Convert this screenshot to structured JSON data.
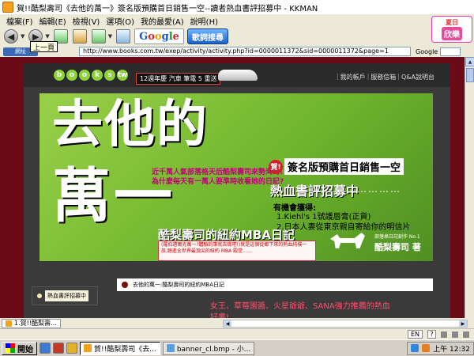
{
  "window": {
    "title": "賀!!酷梨壽司《去他的萬一》簽名版預購首日銷售一空--讀者熱血書評招募中 - KKMAN"
  },
  "menu": [
    "檔案(F)",
    "編輯(E)",
    "檢視(V)",
    "選項(O)",
    "我的最愛(A)",
    "說明(H)"
  ],
  "toolbar": {
    "back_tooltip": "上一頁",
    "song_search": "歌詞搜尋",
    "google_logo": "Google"
  },
  "app_logo": {
    "top": "夏日",
    "bottom": "欣樂"
  },
  "address": {
    "label": "網址",
    "url": "http://www.books.com.tw/exep/activity/activity.php?id=0000011372&sid=0000011372&page=1",
    "search_engine": "Google"
  },
  "site": {
    "logo_letters": [
      "b",
      "o",
      "o",
      "k",
      "s",
      "tw"
    ],
    "nav_badge": "12週年慶 汽車 筆電 5 重送",
    "nav_links": [
      "我的帳戶",
      "服務信箱",
      "Q&A說明台"
    ]
  },
  "banner": {
    "title_line1": "去他的",
    "title_line2": "萬一",
    "promo_line1": "近千萬人氣部落格天后酷梨壽司來勢洶洶!",
    "promo_line2": "為什麼每天有一萬人要準時收看她的日記?",
    "subtitle": "酷梨壽司的紐約MBA日記",
    "note": "(羅伯邁爾克萬一?體驗的事就去做吧!)就是這個從鄉下來的熱血純樸一族,踏進全世界最頂尖的紐約 MBA 殿堂……",
    "headline_badge": "賀!",
    "headline_text": "簽名版預購首日銷售一空",
    "recruit": "熱血書評招募中",
    "recruit_dots": "……………",
    "chance": "有機會獲得:",
    "prizes": [
      "1.Kiehl's 1號護唇膏(正貨)",
      "2.日本人妻從東京親自寄給你的明信片"
    ],
    "author_caption": "部落格日記創作 No.1",
    "author_name": "酷梨壽司 著"
  },
  "lower": {
    "left_tab": "熱血書評招募中",
    "breadcrumb": "去他的萬一:酷梨壽司的紐約MBA日記",
    "pink_line1": "女王、草莓園醬、火星爺爺、SANA強力推薦的熱血",
    "pink_line2": "好書!"
  },
  "tabs": {
    "page_tab": "1.賀!!酷梨壽..."
  },
  "status": {
    "lang": "EN"
  },
  "taskbar": {
    "start": "開始",
    "tasks": [
      "賀!!酷梨壽司《去...",
      "banner_cl.bmp - 小..."
    ],
    "clock": "上午 12:32"
  },
  "colors": {
    "banner_green": "#7ec33a",
    "content_bg": "#6b0b17",
    "pink_text": "#ff4d6d"
  }
}
